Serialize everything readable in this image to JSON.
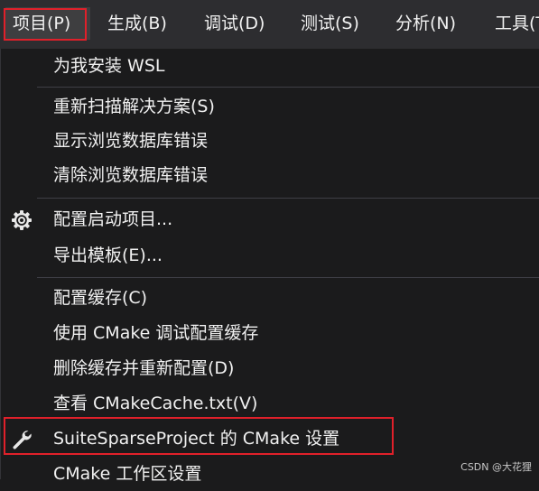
{
  "menubar": {
    "items": [
      {
        "label": "项目(P)"
      },
      {
        "label": "生成(B)"
      },
      {
        "label": "调试(D)"
      },
      {
        "label": "测试(S)"
      },
      {
        "label": "分析(N)"
      },
      {
        "label": "工具(T"
      }
    ]
  },
  "menu": {
    "items": [
      {
        "label": "为我安装 WSL"
      },
      {
        "label": "重新扫描解决方案(S)"
      },
      {
        "label": "显示浏览数据库错误"
      },
      {
        "label": "清除浏览数据库错误"
      },
      {
        "label": "配置启动项目...",
        "icon": "gear-icon"
      },
      {
        "label": "导出模板(E)..."
      },
      {
        "label": "配置缓存(C)"
      },
      {
        "label": "使用 CMake 调试配置缓存"
      },
      {
        "label": "删除缓存并重新配置(D)"
      },
      {
        "label": "查看 CMakeCache.txt(V)"
      },
      {
        "label": "SuiteSparseProject 的 CMake 设置",
        "icon": "wrench-icon"
      },
      {
        "label": "CMake 工作区设置"
      }
    ]
  },
  "colors": {
    "background": "#1b1b1c",
    "menubar": "#2d2d30",
    "text": "#f1f1f1",
    "highlight_border": "#e0202a",
    "separator": "#3f3f46"
  },
  "watermark": "CSDN @大花狸"
}
